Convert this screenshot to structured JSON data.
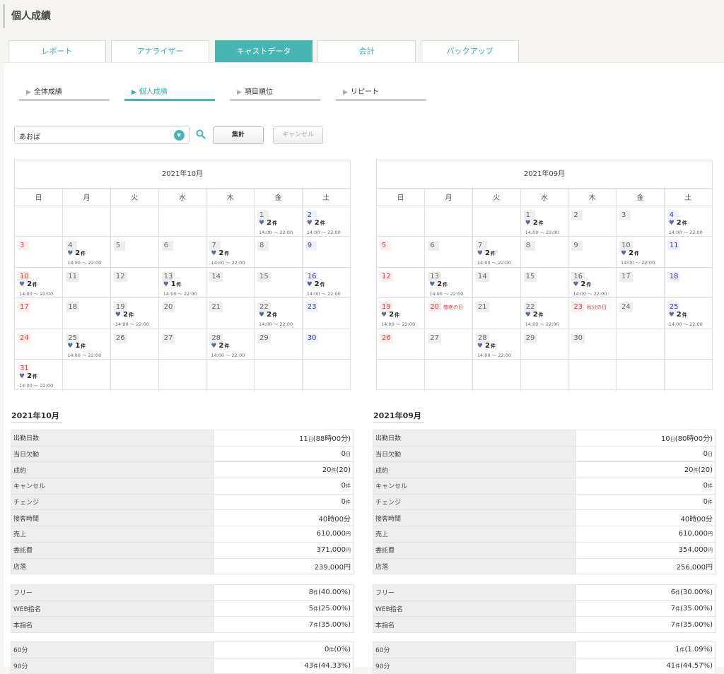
{
  "page": {
    "title": "個人成績"
  },
  "tabs": [
    "レポート",
    "アナライザー",
    "キャストデータ",
    "会計",
    "バックアップ"
  ],
  "subtabs": [
    "全体成績",
    "個人成績",
    "項目順位",
    "リピート"
  ],
  "filter": {
    "cast": "あおば",
    "aggregate": "集計",
    "cancel": "キャンセル"
  },
  "weekdays": [
    "日",
    "月",
    "火",
    "水",
    "木",
    "金",
    "土"
  ],
  "event_unit": "件",
  "calendars": [
    {
      "title": "2021年10月",
      "start": 5,
      "days": 31,
      "holidays": {},
      "events": {
        "1": [
          2,
          "14:00 ～ 22:00"
        ],
        "2": [
          2,
          "14:00 ～ 22:00"
        ],
        "4": [
          2,
          "14:00 ～ 22:00"
        ],
        "7": [
          2,
          "14:00 ～ 22:00"
        ],
        "10": [
          2,
          "14:00 ～ 22:00"
        ],
        "13": [
          1,
          "14:00 ～ 22:00"
        ],
        "16": [
          2,
          "14:00 ～ 22:00"
        ],
        "19": [
          2,
          "14:00 ～ 22:00"
        ],
        "22": [
          2,
          "14:00 ～ 22:00"
        ],
        "25": [
          1,
          "14:00 ～ 22:00"
        ],
        "28": [
          2,
          "14:00 ～ 22:00"
        ],
        "31": [
          2,
          "14:00 ～ 22:00"
        ]
      }
    },
    {
      "title": "2021年09月",
      "start": 3,
      "days": 30,
      "holidays": {
        "20": "敬老の日",
        "23": "秋分の日"
      },
      "events": {
        "1": [
          2,
          "14:00 ～ 22:00"
        ],
        "4": [
          2,
          "14:00 ～ 22:00"
        ],
        "7": [
          2,
          "14:00 ～ 22:00"
        ],
        "10": [
          2,
          "14:00 ～ 22:00"
        ],
        "13": [
          2,
          "14:00 ～ 22:00"
        ],
        "16": [
          2,
          "14:00 ～ 22:00"
        ],
        "19": [
          2,
          "14:00 ～ 22:00"
        ],
        "22": [
          2,
          "14:00 ～ 22:00"
        ],
        "25": [
          2,
          "14:00 ～ 22:00"
        ],
        "28": [
          2,
          "14:00 ～ 22:00"
        ]
      }
    }
  ],
  "summaries": [
    {
      "title": "2021年10月",
      "groups": [
        [
          [
            "出勤日数",
            "11",
            "日",
            "(88時00分)"
          ],
          [
            "当日欠勤",
            "0",
            "日",
            ""
          ],
          [
            "成約",
            "20",
            "件",
            "(20)"
          ],
          [
            "キャンセル",
            "0",
            "件",
            ""
          ],
          [
            "チェンジ",
            "0",
            "件",
            ""
          ],
          [
            "接客時間",
            "40時00分",
            "",
            ""
          ],
          [
            "売上",
            "610,000",
            "円",
            ""
          ],
          [
            "委託費",
            "371,000",
            "円",
            ""
          ],
          [
            "店落",
            "239,000円",
            "",
            ""
          ]
        ],
        [
          [
            "フリー",
            "8",
            "件",
            "(40.00%)"
          ],
          [
            "WEB指名",
            "5",
            "件",
            "(25.00%)"
          ],
          [
            "本指名",
            "7",
            "件",
            "(35.00%)"
          ]
        ],
        [
          [
            "60分",
            "0",
            "件",
            "(0%)"
          ],
          [
            "90分",
            "43",
            "件",
            "(44.33%)"
          ]
        ]
      ]
    },
    {
      "title": "2021年09月",
      "groups": [
        [
          [
            "出勤日数",
            "10",
            "日",
            "(80時00分)"
          ],
          [
            "当日欠勤",
            "0",
            "日",
            ""
          ],
          [
            "成約",
            "20",
            "件",
            "(20)"
          ],
          [
            "キャンセル",
            "0",
            "件",
            ""
          ],
          [
            "チェンジ",
            "0",
            "件",
            ""
          ],
          [
            "接客時間",
            "40時00分",
            "",
            ""
          ],
          [
            "売上",
            "610,000",
            "円",
            ""
          ],
          [
            "委託費",
            "354,000",
            "円",
            ""
          ],
          [
            "店落",
            "256,000円",
            "",
            ""
          ]
        ],
        [
          [
            "フリー",
            "6",
            "件",
            "(30.00%)"
          ],
          [
            "WEB指名",
            "7",
            "件",
            "(35.00%)"
          ],
          [
            "本指名",
            "7",
            "件",
            "(35.00%)"
          ]
        ],
        [
          [
            "60分",
            "1",
            "件",
            "(1.09%)"
          ],
          [
            "90分",
            "41",
            "件",
            "(44.57%)"
          ]
        ]
      ]
    }
  ]
}
